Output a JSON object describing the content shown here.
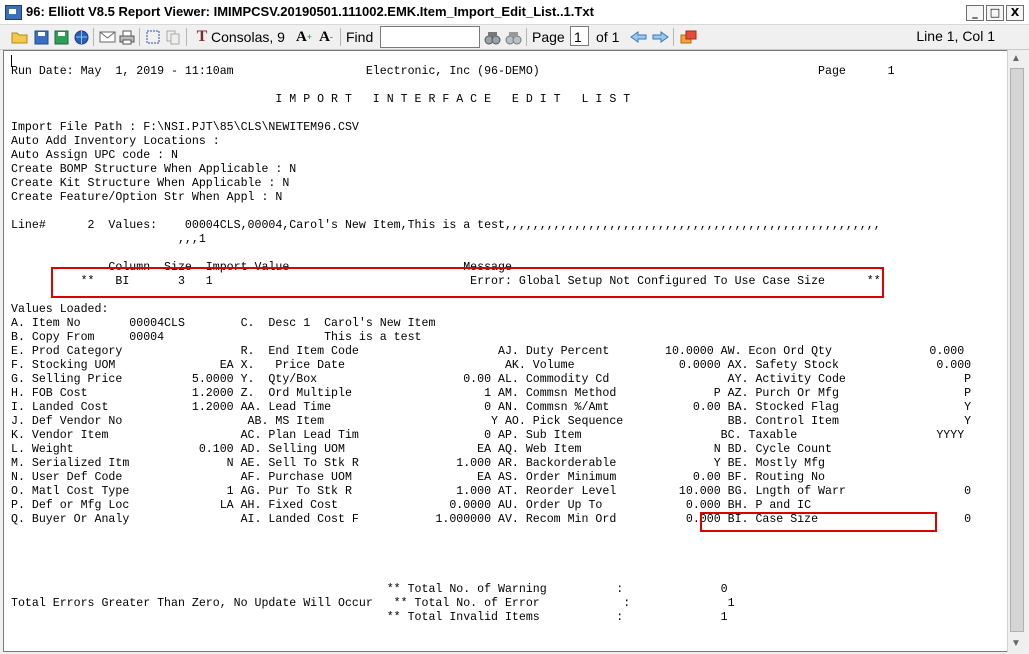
{
  "window": {
    "title": "96: Elliott V8.5 Report Viewer: IMIMPCSV.20190501.111002.EMK.Item_Import_Edit_List..1.Txt",
    "controls": [
      "_",
      "□",
      "X"
    ]
  },
  "toolbar": {
    "font_label": "Consolas, 9",
    "find_label": "Find",
    "find_value": "",
    "page_label": "Page",
    "page_value": "1",
    "of_label": "of 1",
    "position": "Line 1, Col 1"
  },
  "report": {
    "lines": [
      "Run Date: May  1, 2019 - 11:10am                   Electronic, Inc (96-DEMO)                                        Page      1",
      "",
      "                                      I M P O R T   I N T E R F A C E   E D I T   L I S T",
      "",
      "Import File Path : F:\\NSI.PJT\\85\\CLS\\NEWITEM96.CSV",
      "Auto Add Inventory Locations :",
      "Auto Assign UPC code : N",
      "Create BOMP Structure When Applicable : N",
      "Create Kit Structure When Applicable : N",
      "Create Feature/Option Str When Appl : N",
      "",
      "Line#      2  Values:    00004CLS,00004,Carol's New Item,This is a test,,,,,,,,,,,,,,,,,,,,,,,,,,,,,,,,,,,,,,,,,,,,,,,,,,,,,,",
      "                        ,,,1",
      "",
      "              Column  Size  Import Value                         Message",
      "          **   BI       3   1                                     Error: Global Setup Not Configured To Use Case Size      **",
      "",
      "Values Loaded:",
      "A. Item No       00004CLS        C.  Desc 1  Carol's New Item",
      "B. Copy From     00004                       This is a test",
      "E. Prod Category                 R.  End Item Code                    AJ. Duty Percent        10.0000 AW. Econ Ord Qty              0.000",
      "F. Stocking UOM               EA X.   Price Date                       AK. Volume               0.0000 AX. Safety Stock              0.000",
      "G. Selling Price          5.0000 Y.  Qty/Box                     0.00 AL. Commodity Cd                 AY. Activity Code                 P",
      "H. FOB Cost               1.2000 Z.  Ord Multiple                   1 AM. Commsn Method              P AZ. Purch Or Mfg                  P",
      "I. Landed Cost            1.2000 AA. Lead Time                      0 AN. Commsn %/Amt            0.00 BA. Stocked Flag                  Y",
      "J. Def Vendor No                  AB. MS Item                        Y AO. Pick Sequence               BB. Control Item                  Y",
      "K. Vendor Item                   AC. Plan Lead Tim                  0 AP. Sub Item                    BC. Taxable                    YYYY",
      "L. Weight                  0.100 AD. Selling UOM                   EA AQ. Web Item                   N BD. Cycle Count",
      "M. Serialized Itm              N AE. Sell To Stk R              1.000 AR. Backorderable              Y BE. Mostly Mfg",
      "N. User Def Code                 AF. Purchase UOM                  EA AS. Order Minimum           0.00 BF. Routing No",
      "O. Matl Cost Type              1 AG. Pur To Stk R               1.000 AT. Reorder Level         10.000 BG. Lngth of Warr                 0",
      "P. Def or Mfg Loc             LA AH. Fixed Cost                0.0000 AU. Order Up To            0.000 BH. P and IC",
      "Q. Buyer Or Analy                AI. Landed Cost F           1.000000 AV. Recom Min Ord          0.000 BI. Case Size                     0",
      "",
      "",
      "",
      "",
      "                                                      ** Total No. of Warning          :              0",
      "Total Errors Greater Than Zero, No Update Will Occur   ** Total No. of Error            :              1",
      "                                                      ** Total Invalid Items           :              1"
    ]
  }
}
